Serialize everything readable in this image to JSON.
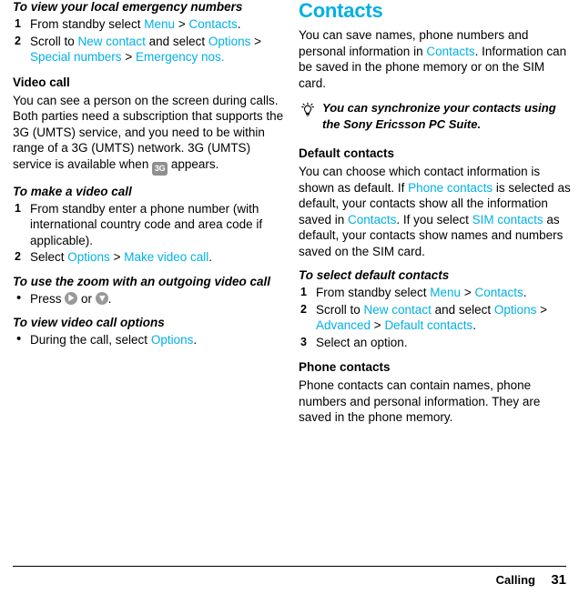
{
  "left_column": {
    "section1": {
      "heading": "To view your local emergency numbers",
      "steps": [
        {
          "parts": [
            {
              "t": "From standby select ",
              "link": false
            },
            {
              "t": "Menu",
              "link": true
            },
            {
              "t": " > ",
              "link": false
            },
            {
              "t": "Contacts",
              "link": true
            },
            {
              "t": ".",
              "link": false
            }
          ]
        },
        {
          "parts": [
            {
              "t": "Scroll to ",
              "link": false
            },
            {
              "t": "New contact",
              "link": true
            },
            {
              "t": " and select ",
              "link": false
            },
            {
              "t": "Options",
              "link": true
            },
            {
              "t": " > ",
              "link": false
            },
            {
              "t": "Special numbers",
              "link": true
            },
            {
              "t": " > ",
              "link": false
            },
            {
              "t": "Emergency nos.",
              "link": true
            }
          ]
        }
      ]
    },
    "section2": {
      "heading": "Video call",
      "body_parts": [
        {
          "t": "You can see a person on the screen during calls. Both parties need a subscription that supports the 3G (UMTS) service, and you need to be within range of a 3G (UMTS) network. 3G (UMTS) service is available when ",
          "link": false
        },
        {
          "t": "3G-ICON",
          "icon": "3g"
        },
        {
          "t": " appears.",
          "link": false
        }
      ]
    },
    "section3": {
      "heading": "To make a video call",
      "steps": [
        {
          "parts": [
            {
              "t": "From standby enter a phone number (with international country code and area code if applicable).",
              "link": false
            }
          ]
        },
        {
          "parts": [
            {
              "t": "Select ",
              "link": false
            },
            {
              "t": "Options",
              "link": true
            },
            {
              "t": " > ",
              "link": false
            },
            {
              "t": "Make video call",
              "link": true
            },
            {
              "t": ".",
              "link": false
            }
          ]
        }
      ]
    },
    "section4": {
      "heading": "To use the zoom with an outgoing video call",
      "bullets": [
        {
          "parts": [
            {
              "t": "Press ",
              "link": false
            },
            {
              "t": "KEY-UP",
              "icon": "key-up"
            },
            {
              "t": " or ",
              "link": false
            },
            {
              "t": "KEY-DOWN",
              "icon": "key-down"
            },
            {
              "t": ".",
              "link": false
            }
          ]
        }
      ]
    },
    "section5": {
      "heading": "To view video call options",
      "bullets": [
        {
          "parts": [
            {
              "t": "During the call, select ",
              "link": false
            },
            {
              "t": "Options",
              "link": true
            },
            {
              "t": ".",
              "link": false
            }
          ]
        }
      ]
    }
  },
  "right_column": {
    "chapter_title": "Contacts",
    "intro_parts": [
      {
        "t": "You can save names, phone numbers and personal information in ",
        "link": false
      },
      {
        "t": "Contacts",
        "link": true
      },
      {
        "t": ". Information can be saved in the phone memory or on the SIM card.",
        "link": false
      }
    ],
    "tip": {
      "icon": "lightbulb-icon",
      "text": "You can synchronize your contacts using the Sony Ericsson PC Suite."
    },
    "section1": {
      "heading": "Default contacts",
      "body_parts": [
        {
          "t": "You can choose which contact information is shown as default. If ",
          "link": false
        },
        {
          "t": "Phone contacts",
          "link": true
        },
        {
          "t": " is selected as default, your contacts show all the information saved in ",
          "link": false
        },
        {
          "t": "Contacts",
          "link": true
        },
        {
          "t": ". If you select ",
          "link": false
        },
        {
          "t": "SIM contacts",
          "link": true
        },
        {
          "t": " as default, your contacts show names and numbers saved on the SIM card.",
          "link": false
        }
      ]
    },
    "section2": {
      "heading": "To select default contacts",
      "steps": [
        {
          "parts": [
            {
              "t": "From standby select ",
              "link": false
            },
            {
              "t": "Menu",
              "link": true
            },
            {
              "t": " > ",
              "link": false
            },
            {
              "t": "Contacts",
              "link": true
            },
            {
              "t": ".",
              "link": false
            }
          ]
        },
        {
          "parts": [
            {
              "t": "Scroll to ",
              "link": false
            },
            {
              "t": "New contact",
              "link": true
            },
            {
              "t": " and select ",
              "link": false
            },
            {
              "t": "Options",
              "link": true
            },
            {
              "t": " > ",
              "link": false
            },
            {
              "t": "Advanced",
              "link": true
            },
            {
              "t": " > ",
              "link": false
            },
            {
              "t": "Default contacts",
              "link": true
            },
            {
              "t": ".",
              "link": false
            }
          ]
        },
        {
          "parts": [
            {
              "t": "Select an option.",
              "link": false
            }
          ]
        }
      ]
    },
    "section3": {
      "heading": "Phone contacts",
      "body_parts": [
        {
          "t": "Phone contacts can contain names, phone numbers and personal information. They are saved in the phone memory.",
          "link": false
        }
      ]
    }
  },
  "footer": {
    "section_label": "Calling",
    "page_number": "31"
  },
  "colors": {
    "link": "#00b0e6",
    "chapter_title": "#00b0e6",
    "text": "#000000"
  }
}
